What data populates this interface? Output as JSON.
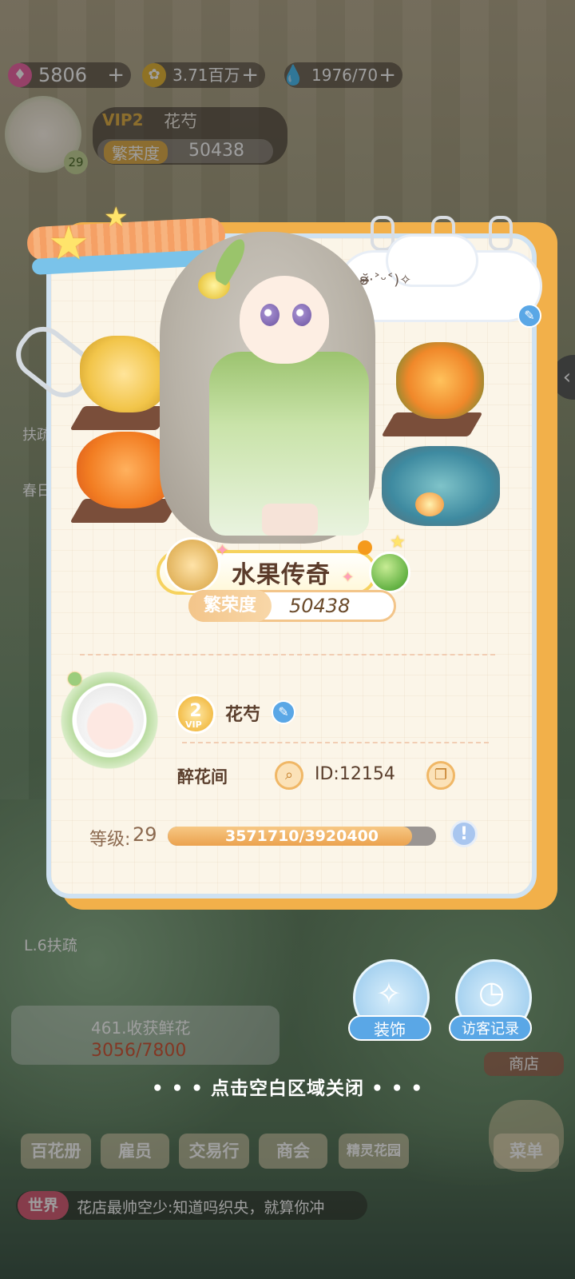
{
  "resources": {
    "gems": "5806",
    "coins": "3.71百万",
    "energy": "1976/70",
    "plus": "+"
  },
  "mini_profile": {
    "vip": "VIP2",
    "name": "花芍",
    "prosperity_label": "繁荣度",
    "prosperity_value": "50438",
    "level": "29"
  },
  "card": {
    "mood_text": "ʚ̴̶̷̆‧˃ᵕ˂)✧",
    "shop_title": "水果传奇",
    "prosperity_label": "繁荣度",
    "prosperity_value": "50438",
    "vip_level": "2",
    "vip_sub": "VIP",
    "player_name": "花芍",
    "shop_name": "醉花间",
    "player_id": "ID:12154",
    "level_label": "等级:",
    "level_value": "29",
    "exp_text": "3571710/3920400",
    "exp_fraction": 0.9103,
    "info": "!"
  },
  "actions": {
    "decorate": "装饰",
    "visitor_log": "访客记录"
  },
  "close_hint": "• • •  点击空白区域关闭  • • •",
  "background": {
    "task_title": "461.收获鲜花",
    "task_progress": "3056/7800",
    "side_item": "L.6扶疏",
    "side_label_1": "扶疏",
    "side_label_2": "春日",
    "shop_tag": "商店",
    "nav": [
      "百花册",
      "雇员",
      "交易行",
      "商会",
      "精灵花园"
    ],
    "menu": "菜单",
    "chat_channel": "世界",
    "chat_message": "花店最帅空少:知道吗织央，就算你冲"
  },
  "colors": {
    "card_bg": "#fbf5e8",
    "card_frame": "#f2b04a",
    "accent_blue": "#5aa7e6",
    "exp_fill": "#eba24e"
  }
}
